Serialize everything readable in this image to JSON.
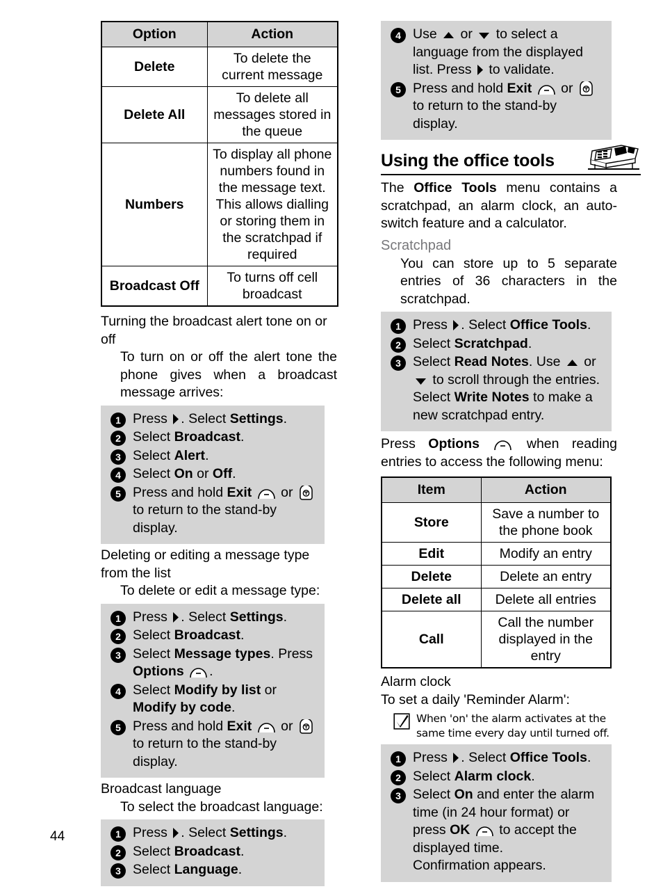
{
  "page": {
    "folio": "44"
  },
  "left": {
    "options_table": {
      "headers": [
        "Option",
        "Action"
      ],
      "rows": [
        {
          "option": "Delete",
          "action": "To delete the current message"
        },
        {
          "option": "Delete All",
          "action": "To delete all messages stored in the queue"
        },
        {
          "option": "Numbers",
          "action": "To display all phone numbers found in the message text. This allows dialling or storing them in the scratchpad if required"
        },
        {
          "option": "Broadcast Off",
          "action": "To turns off cell broadcast"
        }
      ]
    },
    "alert_tone": {
      "heading": "Turning the broadcast alert tone on or off",
      "intro": "To turn on or off the alert tone the phone gives when a broadcast message arrives:",
      "steps": [
        {
          "num": "1",
          "pre": "Press ",
          "key": "right-key-icon",
          "post": ". Select ",
          "bold": "Settings",
          "tail": "."
        },
        {
          "num": "2",
          "pre": "Select ",
          "bold": "Broadcast",
          "tail": "."
        },
        {
          "num": "3",
          "pre": "Select ",
          "bold": "Alert",
          "tail": "."
        },
        {
          "num": "4",
          "pre": "Select ",
          "bold": "On",
          "mid": " or ",
          "bold2": "Off",
          "tail": "."
        },
        {
          "num": "5",
          "pre": "Press and hold ",
          "bold": "Exit",
          "keys": "soft-key-icon or end-key-icon",
          "tail": " to return to the stand-by display."
        }
      ]
    },
    "delete_edit": {
      "heading": "Deleting or editing a message type from the list",
      "intro": "To delete or edit a message type:",
      "steps": [
        {
          "num": "1",
          "pre": "Press ",
          "post": ". Select ",
          "bold": "Settings",
          "tail": "."
        },
        {
          "num": "2",
          "pre": "Select ",
          "bold": "Broadcast",
          "tail": "."
        },
        {
          "num": "3",
          "pre": "Select ",
          "bold": "Message types",
          "tail": ". Press ",
          "bold2": "Options",
          "tail2": "."
        },
        {
          "num": "4",
          "pre": "Select ",
          "bold": "Modify by list",
          "mid": " or ",
          "bold2": "Modify by code",
          "tail": "."
        },
        {
          "num": "5",
          "pre": "Press and hold ",
          "bold": "Exit",
          "tail": " to return to the stand-by display."
        }
      ]
    },
    "language": {
      "heading": "Broadcast language",
      "intro": "To select the broadcast language:",
      "steps": [
        {
          "num": "1",
          "pre": "Press ",
          "post": ". Select ",
          "bold": "Settings",
          "tail": "."
        },
        {
          "num": "2",
          "pre": "Select ",
          "bold": "Broadcast",
          "tail": "."
        },
        {
          "num": "3",
          "pre": "Select ",
          "bold": "Language",
          "tail": "."
        }
      ]
    }
  },
  "right": {
    "language_cont": {
      "steps": [
        {
          "num": "4",
          "pre": "Use ",
          "mid": " or ",
          "post": " to select a language from the displayed list. Press ",
          "tail": " to validate."
        },
        {
          "num": "5",
          "pre": "Press and hold ",
          "bold": "Exit",
          "mid": " or ",
          "tail": " to return to the stand-by display."
        }
      ]
    },
    "section": {
      "title": "Using the office tools",
      "icon": "office-desk-icon",
      "intro_1": "The ",
      "intro_bold": "Office Tools",
      "intro_2": " menu contains a scratchpad, an alarm clock, an auto-switch feature and a calculator."
    },
    "scratchpad": {
      "heading": "Scratchpad",
      "intro": "You can store up to 5 separate entries of 36 characters in the scratchpad.",
      "steps": [
        {
          "num": "1",
          "pre": "Press ",
          "post": ". Select ",
          "bold": "Office Tools",
          "tail": "."
        },
        {
          "num": "2",
          "pre": "Select ",
          "bold": "Scratchpad",
          "tail": "."
        },
        {
          "num": "3",
          "pre": "Select ",
          "bold": "Read Notes",
          "mid": ". Use ",
          "mid2": " or ",
          "post": " to scroll through the entries.",
          "line2_pre": "Select ",
          "line2_bold": "Write Notes",
          "line2_tail": " to make a new scratchpad entry."
        }
      ],
      "after_pre": "Press ",
      "after_bold": "Options",
      "after_tail": " when reading entries to access the following menu:",
      "menu_table": {
        "headers": [
          "Item",
          "Action"
        ],
        "rows": [
          {
            "item": "Store",
            "action": "Save a number to the phone book"
          },
          {
            "item": "Edit",
            "action": "Modify an entry"
          },
          {
            "item": "Delete",
            "action": "Delete an entry"
          },
          {
            "item": "Delete all",
            "action": "Delete all entries"
          },
          {
            "item": "Call",
            "action": "Call the number displayed in the entry"
          }
        ]
      }
    },
    "alarm": {
      "heading": "Alarm clock",
      "subheading": "To set a daily 'Reminder Alarm':",
      "note": "When 'on' the alarm activates at the same time every day until turned off.",
      "steps": [
        {
          "num": "1",
          "pre": "Press ",
          "post": ". Select ",
          "bold": "Office Tools",
          "tail": "."
        },
        {
          "num": "2",
          "pre": "Select ",
          "bold": "Alarm clock",
          "tail": "."
        },
        {
          "num": "3",
          "pre": "Select ",
          "bold": "On",
          "mid": " and enter the alarm time (in 24 hour format) or press ",
          "bold2": "OK",
          "tail": " to accept the displayed time.",
          "line2": "Confirmation appears."
        }
      ]
    }
  }
}
